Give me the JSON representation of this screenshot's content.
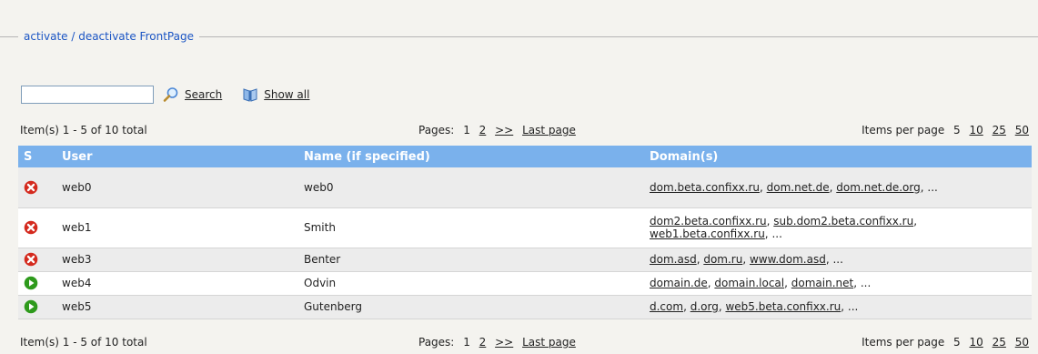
{
  "legend": "activate / deactivate FrontPage",
  "search": {
    "value": "",
    "search_label": "Search",
    "showall_label": "Show all"
  },
  "pager": {
    "items_text": "Item(s) 1 - 5 of 10 total",
    "pages_prefix": "Pages:",
    "current_page": "1",
    "page_2": "2",
    "next": ">>",
    "last": "Last page",
    "perpage_prefix": "Items per page",
    "perpage_current": "5",
    "perpage_10": "10",
    "perpage_25": "25",
    "perpage_50": "50"
  },
  "table": {
    "headers": {
      "s": "S",
      "user": "User",
      "name": "Name (if specified)",
      "domains": "Domain(s)"
    },
    "rows": [
      {
        "status": "inactive",
        "user": "web0",
        "name": "web0",
        "domains": [
          "dom.beta.confixx.ru",
          "dom.net.de",
          "dom.net.de.org"
        ],
        "more": "..."
      },
      {
        "status": "inactive",
        "user": "web1",
        "name": "Smith",
        "domains": [
          "dom2.beta.confixx.ru",
          "sub.dom2.beta.confixx.ru",
          "web1.beta.confixx.ru"
        ],
        "more": "..."
      },
      {
        "status": "inactive",
        "user": "web3",
        "name": "Benter",
        "domains": [
          "dom.asd",
          "dom.ru",
          "www.dom.asd"
        ],
        "more": "..."
      },
      {
        "status": "active",
        "user": "web4",
        "name": "Odvin",
        "domains": [
          "domain.de",
          "domain.local",
          "domain.net"
        ],
        "more": "..."
      },
      {
        "status": "active",
        "user": "web5",
        "name": "Gutenberg",
        "domains": [
          "d.com",
          "d.org",
          "web5.beta.confixx.ru"
        ],
        "more": "..."
      }
    ]
  },
  "colors": {
    "accent": "#1b55c4",
    "header_bg": "#7ab1ec",
    "inactive": "#d42a1e",
    "active": "#2e9a1c"
  },
  "icons": {
    "search": "magnifier-icon",
    "showall": "book-icon",
    "inactive": "red-x-circle-icon",
    "active": "green-play-circle-icon"
  }
}
